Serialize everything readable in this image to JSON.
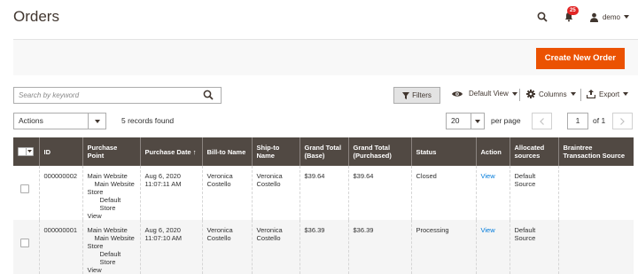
{
  "page": {
    "title": "Orders"
  },
  "header": {
    "notification_count": "25",
    "user_name": "demo"
  },
  "actions_bar": {
    "create_label": "Create New Order"
  },
  "search": {
    "placeholder": "Search by keyword"
  },
  "toolbar": {
    "filters_label": "Filters",
    "view_label": "Default View",
    "columns_label": "Columns",
    "export_label": "Export"
  },
  "mass_actions": {
    "label": "Actions"
  },
  "records_found": "5 records found",
  "pagination": {
    "per_page_value": "20",
    "per_page_label": "per page",
    "current_page": "1",
    "of_label": "of 1"
  },
  "table": {
    "columns": [
      "",
      "ID",
      "Purchase Point",
      "Purchase Date ↑",
      "Bill-to Name",
      "Ship-to Name",
      "Grand Total (Base)",
      "Grand Total (Purchased)",
      "Status",
      "Action",
      "Allocated sources",
      "Braintree Transaction Source"
    ],
    "rows": [
      {
        "id": "000000002",
        "pp1": "Main Website",
        "pp2": "Main Website",
        "pp3": "Store",
        "pp4": "Default Store",
        "pp5": "View",
        "date1": "Aug 6, 2020",
        "date2": "11:07:11 AM",
        "bill1": "Veronica",
        "bill2": "Costello",
        "ship1": "Veronica",
        "ship2": "Costello",
        "total_base": "$39.64",
        "total_purchased": "$39.64",
        "status": "Closed",
        "action": "View",
        "src1": "Default",
        "src2": "Source",
        "braintree": ""
      },
      {
        "id": "000000001",
        "pp1": "Main Website",
        "pp2": "Main Website",
        "pp3": "Store",
        "pp4": "Default Store",
        "pp5": "View",
        "date1": "Aug 6, 2020",
        "date2": "11:07:10 AM",
        "bill1": "Veronica",
        "bill2": "Costello",
        "ship1": "Veronica",
        "ship2": "Costello",
        "total_base": "$36.39",
        "total_purchased": "$36.39",
        "status": "Processing",
        "action": "View",
        "src1": "Default",
        "src2": "Source",
        "braintree": ""
      }
    ]
  },
  "colors": {
    "accent": "#eb5202",
    "header_bg": "#514943",
    "link": "#007bdb",
    "badge": "#e22626"
  },
  "icons": [
    "search-icon",
    "bell-icon",
    "user-icon",
    "filter-icon",
    "eye-icon",
    "gear-icon",
    "export-icon",
    "chevron-down-icon",
    "chevron-left-icon",
    "chevron-right-icon"
  ]
}
